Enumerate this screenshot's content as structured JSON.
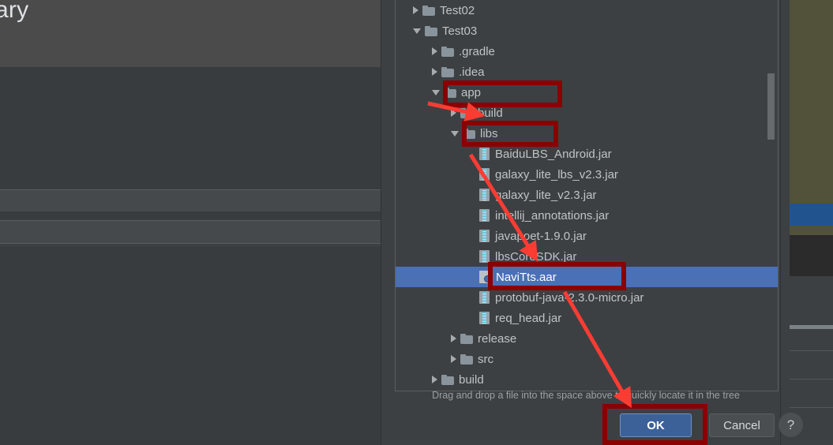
{
  "background": {
    "left_panel_title": "ary",
    "accent_selected": "#4a70b5",
    "olive": "#52513a",
    "blue_row": "#21538f"
  },
  "dialog": {
    "hint": "Drag and drop a file into the space above to quickly locate it in the tree",
    "help_label": "?",
    "buttons": {
      "ok": "OK",
      "cancel": "Cancel"
    },
    "tree": [
      {
        "label": "Test02",
        "icon": "folder",
        "toggle": "collapsed",
        "depth": 1,
        "selected": false
      },
      {
        "label": "Test03",
        "icon": "folder",
        "toggle": "expanded",
        "depth": 1,
        "selected": false
      },
      {
        "label": ".gradle",
        "icon": "folder",
        "toggle": "collapsed",
        "depth": 2,
        "selected": false
      },
      {
        "label": ".idea",
        "icon": "folder",
        "toggle": "collapsed",
        "depth": 2,
        "selected": false
      },
      {
        "label": "app",
        "icon": "folder",
        "toggle": "expanded",
        "depth": 2,
        "selected": false
      },
      {
        "label": "build",
        "icon": "folder",
        "toggle": "collapsed",
        "depth": 3,
        "selected": false
      },
      {
        "label": "libs",
        "icon": "folder",
        "toggle": "expanded",
        "depth": 3,
        "selected": false
      },
      {
        "label": "BaiduLBS_Android.jar",
        "icon": "jar",
        "toggle": "none",
        "depth": 4,
        "selected": false
      },
      {
        "label": "galaxy_lite_lbs_v2.3.jar",
        "icon": "jar",
        "toggle": "none",
        "depth": 4,
        "selected": false
      },
      {
        "label": "galaxy_lite_v2.3.jar",
        "icon": "jar",
        "toggle": "none",
        "depth": 4,
        "selected": false
      },
      {
        "label": "intellij_annotations.jar",
        "icon": "jar",
        "toggle": "none",
        "depth": 4,
        "selected": false
      },
      {
        "label": "javapoet-1.9.0.jar",
        "icon": "jar",
        "toggle": "none",
        "depth": 4,
        "selected": false
      },
      {
        "label": "lbsCoreSDK.jar",
        "icon": "jar",
        "toggle": "none",
        "depth": 4,
        "selected": false
      },
      {
        "label": "NaviTts.aar",
        "icon": "aar",
        "toggle": "none",
        "depth": 4,
        "selected": true
      },
      {
        "label": "protobuf-java-2.3.0-micro.jar",
        "icon": "jar",
        "toggle": "none",
        "depth": 4,
        "selected": false
      },
      {
        "label": "req_head.jar",
        "icon": "jar",
        "toggle": "none",
        "depth": 4,
        "selected": false
      },
      {
        "label": "release",
        "icon": "folder",
        "toggle": "collapsed",
        "depth": 3,
        "selected": false
      },
      {
        "label": "src",
        "icon": "folder",
        "toggle": "collapsed",
        "depth": 3,
        "selected": false
      },
      {
        "label": "build",
        "icon": "folder",
        "toggle": "collapsed",
        "depth": 2,
        "selected": false
      }
    ]
  },
  "annotations": {
    "color": "#8b0000",
    "arrow_color": "#fa3c33",
    "highlight_boxes": [
      "app-row",
      "libs-row",
      "navitts-row",
      "ok-button"
    ],
    "arrows": [
      "app-to-build",
      "libs-to-navitts",
      "navitts-to-ok"
    ]
  }
}
